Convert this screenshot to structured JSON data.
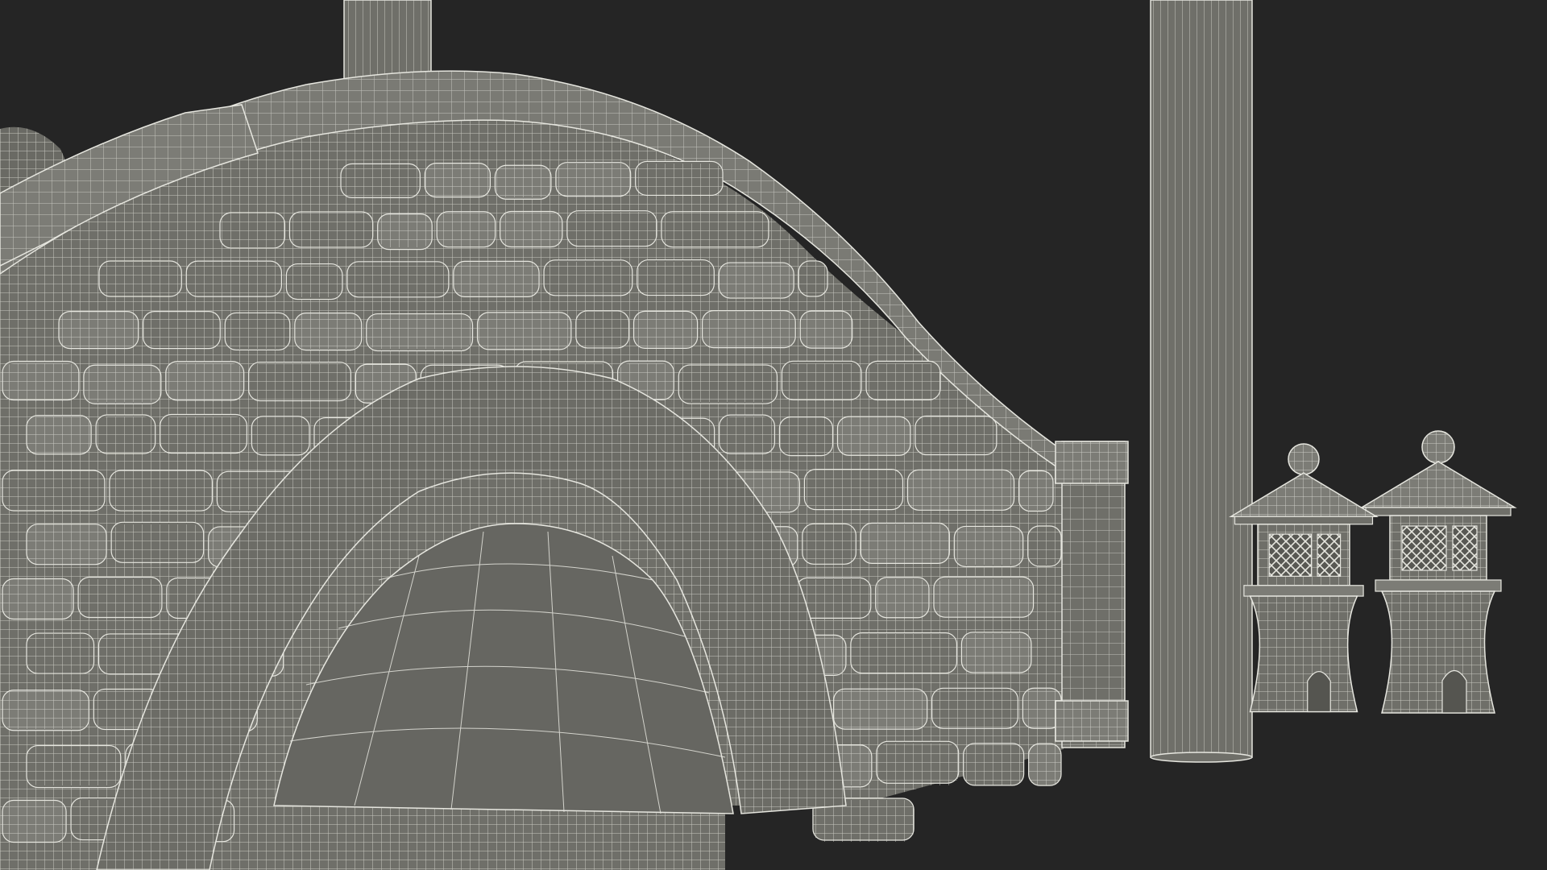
{
  "scene": {
    "background": "#252525",
    "model_fill": "#6f6f69",
    "model_fill_dark": "#595954",
    "model_fill_light": "#7c7c76",
    "wire_color": "#e6e6df",
    "objects": [
      "stone-arch-bridge-wireframe",
      "wooden-post-wireframe",
      "stone-lantern-wireframe"
    ]
  }
}
